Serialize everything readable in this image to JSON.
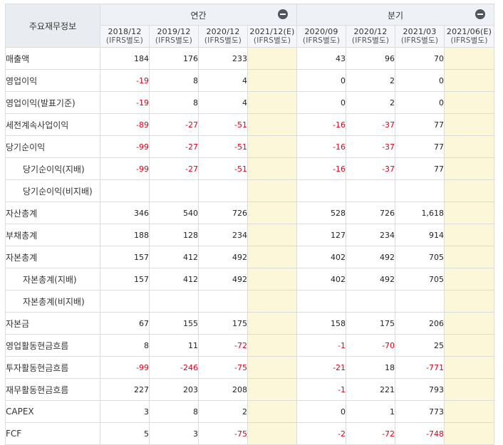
{
  "header": {
    "title": "주요재무정보",
    "annual_label": "연간",
    "quarter_label": "분기",
    "annual_periods": [
      {
        "date": "2018/12",
        "basis": "(IFRS별도)"
      },
      {
        "date": "2019/12",
        "basis": "(IFRS별도)"
      },
      {
        "date": "2020/12",
        "basis": "(IFRS별도)"
      },
      {
        "date": "2021/12(E)",
        "basis": "(IFRS별도)"
      }
    ],
    "quarter_periods": [
      {
        "date": "2020/09",
        "basis": "(IFRS별도)"
      },
      {
        "date": "2020/12",
        "basis": "(IFRS별도)"
      },
      {
        "date": "2021/03",
        "basis": "(IFRS별도)"
      },
      {
        "date": "2021/06(E)",
        "basis": "(IFRS별도)"
      }
    ]
  },
  "colors": {
    "negative": "#e1001a",
    "estimate_bg": "#fcf7d9",
    "header_bg": "#eef1f5"
  },
  "rows": [
    {
      "label": "매출액",
      "indent": false,
      "annual": [
        "184",
        "176",
        "233",
        ""
      ],
      "quarter": [
        "43",
        "96",
        "70",
        ""
      ]
    },
    {
      "label": "영업이익",
      "indent": false,
      "annual": [
        "-19",
        "8",
        "4",
        ""
      ],
      "quarter": [
        "0",
        "2",
        "0",
        ""
      ]
    },
    {
      "label": "영업이익(발표기준)",
      "indent": false,
      "annual": [
        "-19",
        "8",
        "4",
        ""
      ],
      "quarter": [
        "0",
        "2",
        "0",
        ""
      ]
    },
    {
      "label": "세전계속사업이익",
      "indent": false,
      "annual": [
        "-89",
        "-27",
        "-51",
        ""
      ],
      "quarter": [
        "-16",
        "-37",
        "77",
        ""
      ]
    },
    {
      "label": "당기순이익",
      "indent": false,
      "annual": [
        "-99",
        "-27",
        "-51",
        ""
      ],
      "quarter": [
        "-16",
        "-37",
        "77",
        ""
      ]
    },
    {
      "label": "당기순이익(지배)",
      "indent": true,
      "annual": [
        "-99",
        "-27",
        "-51",
        ""
      ],
      "quarter": [
        "-16",
        "-37",
        "77",
        ""
      ]
    },
    {
      "label": "당기순이익(비지배)",
      "indent": true,
      "annual": [
        "",
        "",
        "",
        ""
      ],
      "quarter": [
        "",
        "",
        "",
        ""
      ]
    },
    {
      "label": "자산총계",
      "indent": false,
      "annual": [
        "346",
        "540",
        "726",
        ""
      ],
      "quarter": [
        "528",
        "726",
        "1,618",
        ""
      ]
    },
    {
      "label": "부채총계",
      "indent": false,
      "annual": [
        "188",
        "128",
        "234",
        ""
      ],
      "quarter": [
        "127",
        "234",
        "914",
        ""
      ]
    },
    {
      "label": "자본총계",
      "indent": false,
      "annual": [
        "157",
        "412",
        "492",
        ""
      ],
      "quarter": [
        "402",
        "492",
        "705",
        ""
      ]
    },
    {
      "label": "자본총계(지배)",
      "indent": true,
      "annual": [
        "157",
        "412",
        "492",
        ""
      ],
      "quarter": [
        "402",
        "492",
        "705",
        ""
      ]
    },
    {
      "label": "자본총계(비지배)",
      "indent": true,
      "annual": [
        "",
        "",
        "",
        ""
      ],
      "quarter": [
        "",
        "",
        "",
        ""
      ]
    },
    {
      "label": "자본금",
      "indent": false,
      "annual": [
        "67",
        "155",
        "175",
        ""
      ],
      "quarter": [
        "158",
        "175",
        "206",
        ""
      ]
    },
    {
      "label": "영업활동현금흐름",
      "indent": false,
      "annual": [
        "8",
        "11",
        "-72",
        ""
      ],
      "quarter": [
        "-1",
        "-70",
        "25",
        ""
      ]
    },
    {
      "label": "투자활동현금흐름",
      "indent": false,
      "annual": [
        "-99",
        "-246",
        "-75",
        ""
      ],
      "quarter": [
        "-21",
        "18",
        "-771",
        ""
      ]
    },
    {
      "label": "재무활동현금흐름",
      "indent": false,
      "annual": [
        "227",
        "203",
        "208",
        ""
      ],
      "quarter": [
        "-1",
        "221",
        "793",
        ""
      ]
    },
    {
      "label": "CAPEX",
      "indent": false,
      "annual": [
        "3",
        "8",
        "2",
        ""
      ],
      "quarter": [
        "0",
        "1",
        "773",
        ""
      ]
    },
    {
      "label": "FCF",
      "indent": false,
      "annual": [
        "5",
        "3",
        "-75",
        ""
      ],
      "quarter": [
        "-2",
        "-72",
        "-748",
        ""
      ]
    }
  ]
}
